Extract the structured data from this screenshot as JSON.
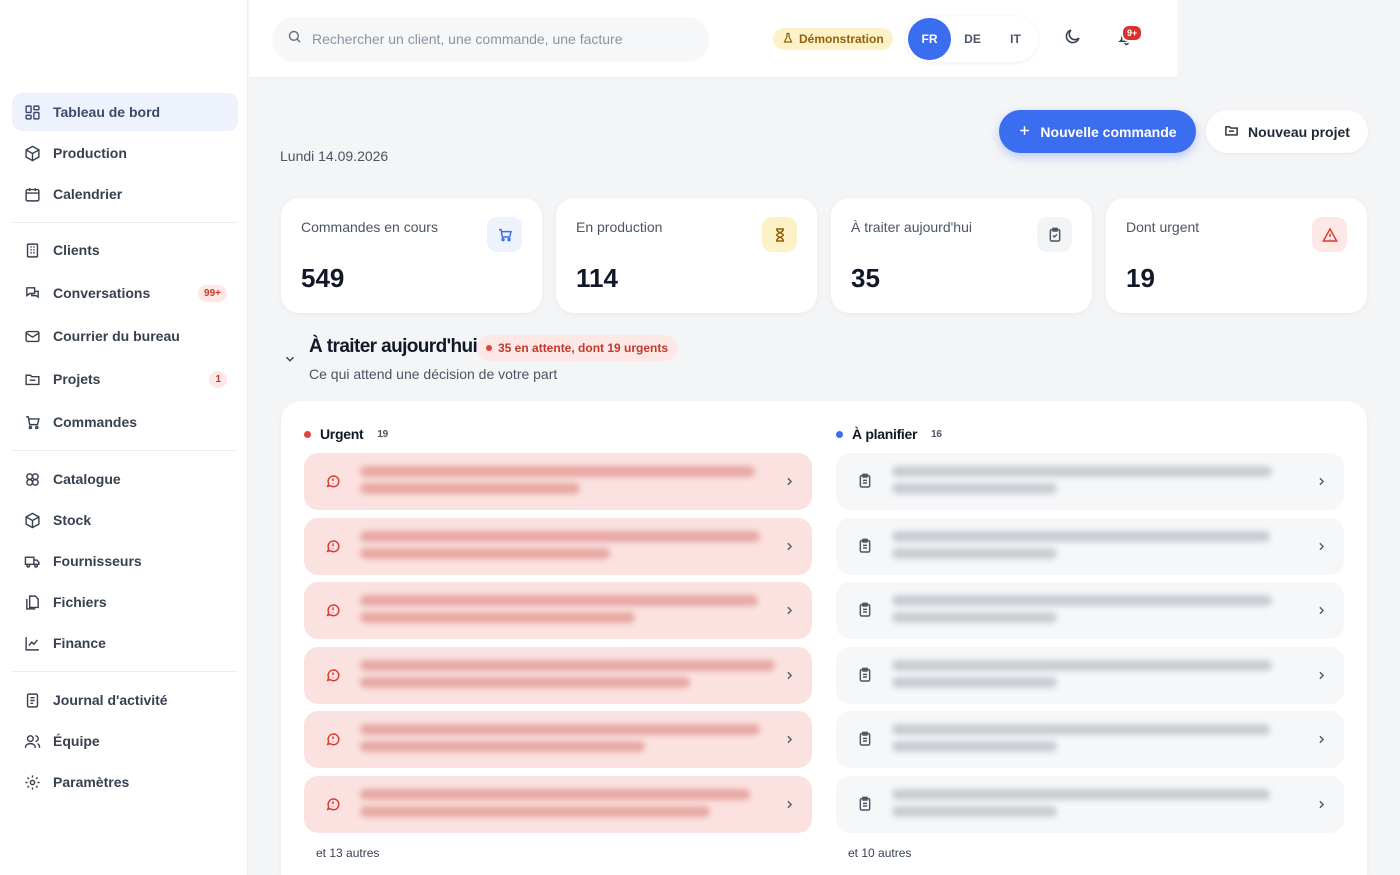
{
  "sidebar": {
    "items": [
      {
        "label": "Tableau de bord",
        "icon": "dashboard-icon",
        "active": true
      },
      {
        "label": "Production",
        "icon": "package-icon"
      },
      {
        "label": "Calendrier",
        "icon": "calendar-icon"
      },
      {
        "label": "Clients",
        "icon": "building-icon"
      },
      {
        "label": "Conversations",
        "icon": "chat-icon",
        "badge": "99+"
      },
      {
        "label": "Courrier du bureau",
        "icon": "mail-icon"
      },
      {
        "label": "Projets",
        "icon": "folder-icon",
        "badge": "1"
      },
      {
        "label": "Commandes",
        "icon": "cart-icon"
      },
      {
        "label": "Catalogue",
        "icon": "catalogue-icon"
      },
      {
        "label": "Stock",
        "icon": "box-icon"
      },
      {
        "label": "Fournisseurs",
        "icon": "truck-icon"
      },
      {
        "label": "Fichiers",
        "icon": "files-icon"
      },
      {
        "label": "Finance",
        "icon": "chart-line-icon"
      },
      {
        "label": "Journal d'activité",
        "icon": "log-icon"
      },
      {
        "label": "Équipe",
        "icon": "users-icon"
      },
      {
        "label": "Paramètres",
        "icon": "gear-icon"
      }
    ]
  },
  "topbar": {
    "search_placeholder": "Rechercher un client, une commande, une facture",
    "demo_label": "Démonstration",
    "languages": [
      "FR",
      "DE",
      "IT"
    ],
    "active_language": "FR",
    "notifications_count": "9+"
  },
  "main": {
    "date": "Lundi 14.09.2026",
    "new_order_label": "Nouvelle commande",
    "new_project_label": "Nouveau projet"
  },
  "stats": [
    {
      "label": "Commandes en cours",
      "value": "549",
      "icon": "cart-icon",
      "icon_bg": "#eef2fc",
      "icon_color": "#3b6df0"
    },
    {
      "label": "En production",
      "value": "114",
      "icon": "hourglass-icon",
      "icon_bg": "#fdf1c8",
      "icon_color": "#92610a"
    },
    {
      "label": "À traiter aujourd'hui",
      "value": "35",
      "icon": "clipboard-check-icon",
      "icon_bg": "#f3f4f6",
      "icon_color": "#4b5563"
    },
    {
      "label": "Dont urgent",
      "value": "19",
      "icon": "alert-triangle-icon",
      "icon_bg": "#fde8e6",
      "icon_color": "#d93a30"
    }
  ],
  "today": {
    "title": "À traiter aujourd'hui",
    "pill": "35 en attente, dont 19 urgents",
    "subtitle": "Ce qui attend une décision de votre part",
    "urgent": {
      "label": "Urgent",
      "count": "19",
      "more": "et 13 autres",
      "color": "#e0463c"
    },
    "plan": {
      "label": "À planifier",
      "count": "16",
      "more": "et 10 autres",
      "color": "#3b6df0"
    }
  },
  "colors": {
    "accent": "#3b6df0",
    "urgent": "#e0463c",
    "urgent_row_bg": "#fbe2e0"
  }
}
